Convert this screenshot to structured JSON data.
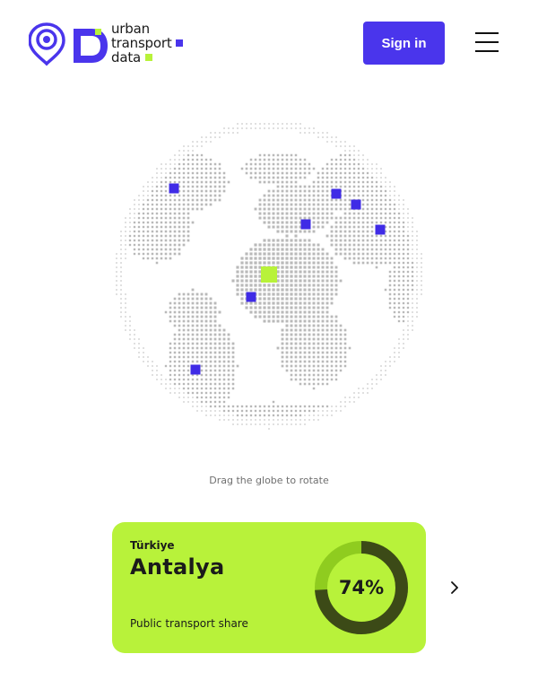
{
  "brand": {
    "line1": "urban",
    "line2": "transport",
    "line3": "data",
    "primary_color": "#4a35ec",
    "accent_color": "#b8f23a"
  },
  "header": {
    "signin_label": "Sign in",
    "menu_icon": "hamburger-menu-icon"
  },
  "globe": {
    "hint": "Drag the globe to rotate",
    "marker_color": "#3f2be6",
    "active_marker_color": "#b8f23a"
  },
  "city_card": {
    "country": "Türkiye",
    "city": "Antalya",
    "metric_value": 74,
    "metric_display": "74%",
    "metric_label": "Public transport share",
    "next_icon": "chevron-right-icon"
  }
}
